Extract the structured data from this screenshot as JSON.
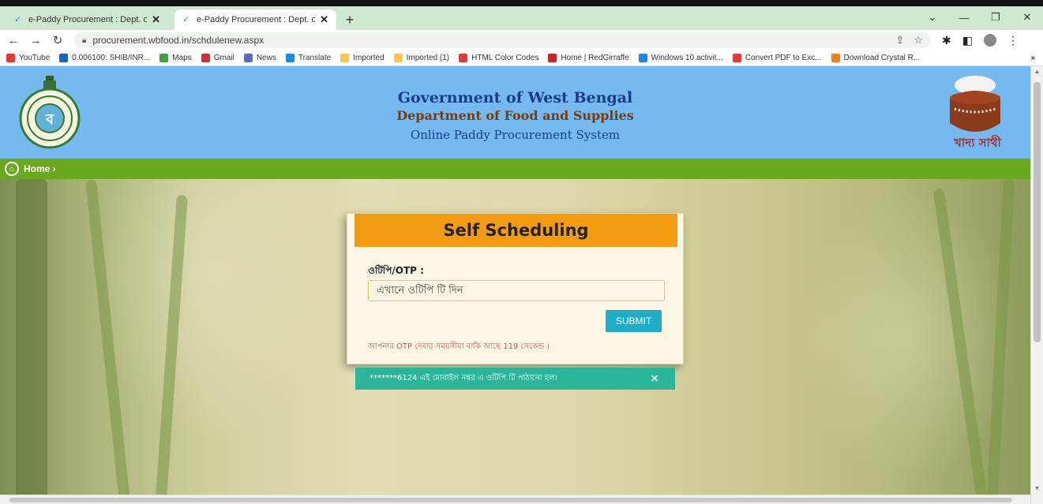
{
  "browser": {
    "tabs": [
      {
        "title": "e-Paddy Procurement : Dept. of F",
        "active": false
      },
      {
        "title": "e-Paddy Procurement : Dept. of F",
        "active": true
      }
    ],
    "url": "procurement.wbfood.in/schdulenew.aspx",
    "bookmarks": [
      {
        "label": "YouTube",
        "color": "#e53935"
      },
      {
        "label": "0.006100: SHIB/INR...",
        "color": "#1565c0"
      },
      {
        "label": "Maps",
        "color": "#43a047"
      },
      {
        "label": "Gmail",
        "color": "#d32f2f"
      },
      {
        "label": "News",
        "color": "#5c6bc0"
      },
      {
        "label": "Translate",
        "color": "#1e88e5"
      },
      {
        "label": "Imported",
        "color": "#f9c74f"
      },
      {
        "label": "Imported (1)",
        "color": "#f9c74f"
      },
      {
        "label": "HTML Color Codes",
        "color": "#e53935"
      },
      {
        "label": "Home | RedGirraffe",
        "color": "#c62828"
      },
      {
        "label": "Windows 10 activit...",
        "color": "#1e88e5"
      },
      {
        "label": "Convert PDF to Exc...",
        "color": "#e53935"
      },
      {
        "label": "Download Crystal R...",
        "color": "#f57f17"
      }
    ]
  },
  "header": {
    "line1": "Government of West Bengal",
    "line2": "Department of Food and Supplies",
    "line3": "Online Paddy Procurement System",
    "logo_right_text": "খাদ্য সাথী",
    "logo_left_text": "ব"
  },
  "nav": {
    "home": "Home ›"
  },
  "form": {
    "title": "Self Scheduling",
    "otp_label": "ওটিপি/OTP :",
    "otp_placeholder": "এখানে ওটিপি টি দিন",
    "submit": "SUBMIT",
    "timer_text": "আপনার OTP দেবার সময়সীমা বাকি আছে 119 সেকেন্ড ।"
  },
  "alert": {
    "message": "*******6124 এই মোবাইল নম্বর এ ওটিপি টি পাঠানো হল।",
    "close": "×"
  },
  "colors": {
    "header_bg": "#74baf0",
    "nav_bg": "#6aa81f",
    "card_head": "#f39c12",
    "submit": "#1eaec8",
    "alert": "#2bb59a"
  }
}
